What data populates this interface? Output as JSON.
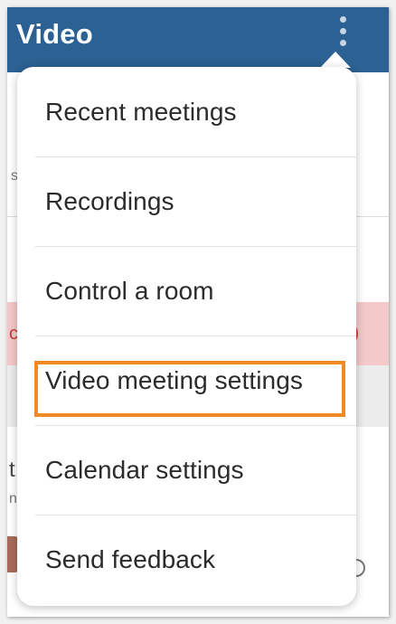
{
  "header": {
    "title": "Video",
    "more_icon": "more-vert-icon"
  },
  "background": {
    "fragments": [
      "s",
      "c",
      "t",
      "n"
    ]
  },
  "menu": {
    "items": [
      {
        "label": "Recent meetings"
      },
      {
        "label": "Recordings"
      },
      {
        "label": "Control a room"
      },
      {
        "label": "Video meeting settings",
        "highlighted": true
      },
      {
        "label": "Calendar settings"
      },
      {
        "label": "Send feedback"
      }
    ]
  },
  "colors": {
    "appbar": "#2c6193",
    "highlight": "#f08a25",
    "alert_row": "#f4c9c9"
  }
}
